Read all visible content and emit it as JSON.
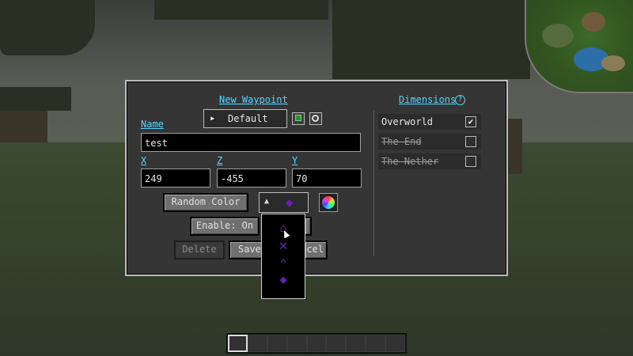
{
  "dialog": {
    "title": "New Waypoint",
    "name_label": "Name",
    "name_value": "test",
    "group_value": "Default",
    "group_arrow": "▸",
    "add_icon": "plus-icon",
    "settings_icon": "search-icon",
    "x_label": "X",
    "x_value": "249",
    "z_label": "Z",
    "z_value": "-455",
    "y_label": "Y",
    "y_value": "70",
    "random_color_label": "Random Color",
    "icon_arrow": "▲",
    "icon_selected": "◆",
    "enable_label": "Enable: On",
    "delete_label": "Delete",
    "save_label": "Save",
    "cancel_label": "Cancel",
    "accent_color": "#55d5ff",
    "waypoint_color": "#6a1fb0"
  },
  "dimensions": {
    "title": "Dimensions",
    "help_icon": "?",
    "items": [
      {
        "label": "Overworld",
        "checked": "✔"
      },
      {
        "label": "The End",
        "checked": ""
      },
      {
        "label": "The Nether",
        "checked": ""
      }
    ]
  },
  "icon_popup": {
    "icons": [
      "⌂",
      "✕",
      "⌃",
      "◆"
    ]
  }
}
